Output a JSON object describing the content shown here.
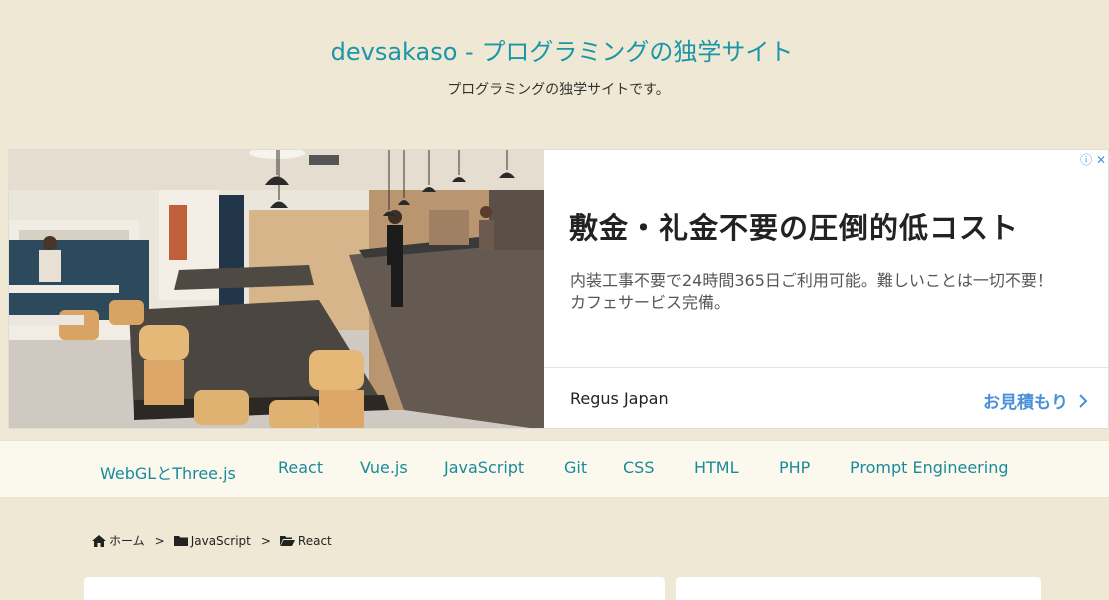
{
  "header": {
    "title": "devsakaso - プログラミングの独学サイト",
    "tagline": "プログラミングの独学サイトです。"
  },
  "ad": {
    "info_icon": "info-close-icon",
    "headline": "敷金・礼金不要の圧倒的低コスト",
    "body": "内装工事不要で24時間365日ご利用可能。難しいことは一切不要！カフェサービス完備。",
    "advertiser": "Regus Japan",
    "cta": "お見積もり"
  },
  "nav": {
    "items": [
      "WebGLとThree.js",
      "React",
      "Vue.js",
      "JavaScript",
      "Git",
      "CSS",
      "HTML",
      "PHP",
      "Prompt Engineering"
    ]
  },
  "breadcrumb": {
    "items": [
      {
        "label": "ホーム",
        "icon": "home-icon"
      },
      {
        "label": "JavaScript",
        "icon": "folder-icon"
      },
      {
        "label": "React",
        "icon": "folder-open-icon"
      }
    ],
    "separator": ">"
  },
  "colors": {
    "background": "#efe8d4",
    "accent": "#1a96a8",
    "nav_background": "#fbf9ee",
    "ad_link": "#4a90d9"
  }
}
